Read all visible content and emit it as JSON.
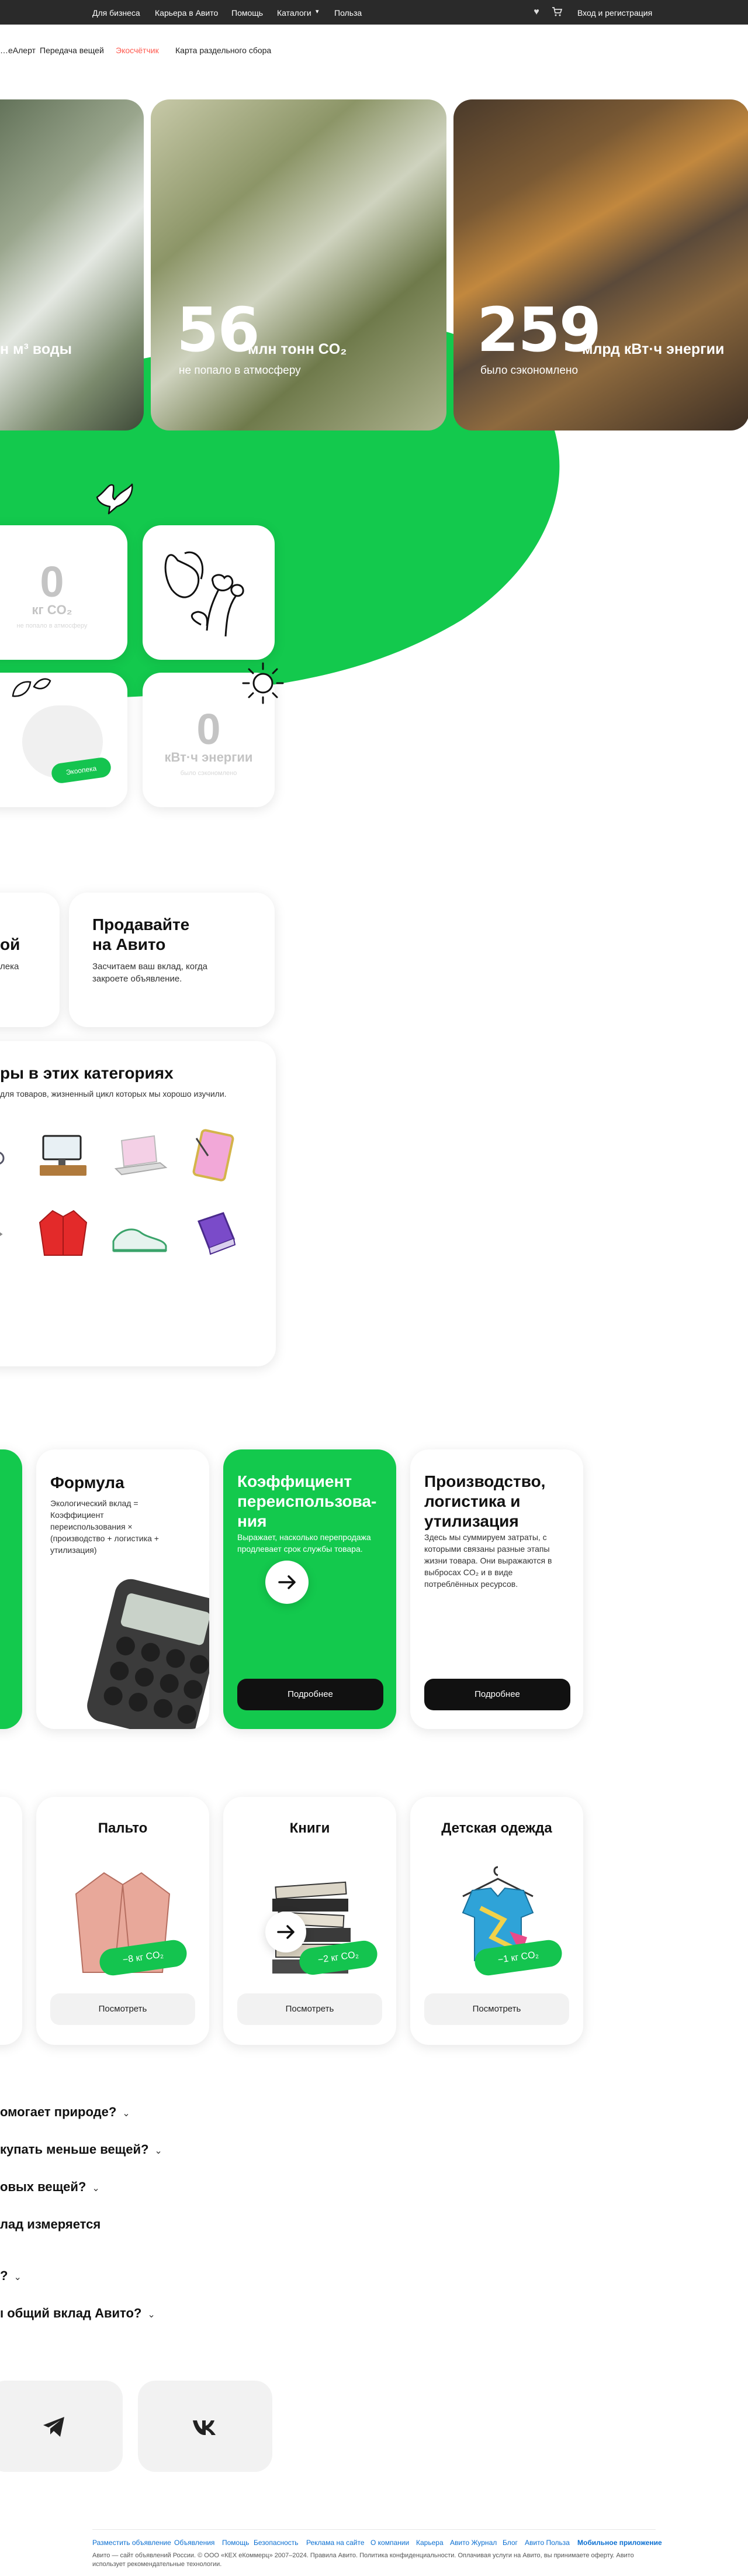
{
  "topbar": {
    "links": [
      "Для бизнеса",
      "Карьера в Авито",
      "Помощь",
      "Каталоги",
      "Польза"
    ],
    "login": "Вход и регистрация"
  },
  "subnav": [
    "…еАлерт",
    "Передача вещей",
    "Экосчётчик",
    "Карта раздельного сбора"
  ],
  "hero": [
    {
      "num": "",
      "unit": "н м³ воды",
      "sub": ""
    },
    {
      "num": "56",
      "unit": "млн тонн CO₂",
      "sub": "не попало в атмосферу"
    },
    {
      "num": "259",
      "unit": "млрд кВт·ч энергии",
      "sub": "было сэкономлено"
    }
  ],
  "tiles": {
    "co2": {
      "zero": "0",
      "unit": "кг CO₂",
      "note": "не попало в атмосферу"
    },
    "energy": {
      "zero": "0",
      "unit": "кВт·ч энергии",
      "note": "было сэкономлено"
    },
    "badge": "Экоопека"
  },
  "sell": {
    "left_title": "ой",
    "left_text": "лека",
    "title": "Продавайте на Авито",
    "text": "Засчитаем ваш вклад, когда закроете объявление."
  },
  "categories": {
    "title": "ры в этих категориях",
    "text": "для товаров, жизненный цикл которых мы хорошо изучили."
  },
  "formula": {
    "f_title": "Формула",
    "f_text": "Экологический вклад = Коэффициент переиспользования × (производство + логистика + утилизация)",
    "k_title": "Коэффициент переиспользова-ния",
    "k_text": "Выражает, насколько перепродажа продлевает срок службы товара.",
    "k_btn": "Подробнее",
    "p_title": "Производство, логистика и утилизация",
    "p_text": "Здесь мы суммируем затраты, с которыми связаны разные этапы жизни товара. Они выражаются в выбросах CO₂ и в виде потреблённых ресурсов.",
    "p_btn": "Подробнее"
  },
  "products": [
    {
      "title": "Пальто",
      "badge": "−8 кг CO₂",
      "btn": "Посмотреть"
    },
    {
      "title": "Книги",
      "badge": "−2 кг CO₂",
      "btn": "Посмотреть"
    },
    {
      "title": "Детская одежда",
      "badge": "−1 кг CO₂",
      "btn": "Посмотреть"
    }
  ],
  "faq": [
    "омогает природе?",
    "купать меньше вещей?",
    "овых вещей?",
    "лад измеряется",
    "?",
    "ı общий вклад Авито?"
  ],
  "footer": {
    "links": [
      "Разместить объявление",
      "Объявления",
      "Помощь",
      "Безопасность",
      "Реклама на сайте",
      "О компании",
      "Карьера",
      "Авито Журнал",
      "Блог",
      "Авито Польза",
      "Мобильное приложение"
    ],
    "copy": "Авито — сайт объявлений России. © ООО «КЕХ еКоммерц» 2007–2024. Правила Авито. Политика конфиденциальности. Оплачивая услуги на Авито, вы принимаете оферту. Авито использует рекомендательные технологии."
  },
  "colors": {
    "green": "#13c94d",
    "dark": "#2a2a2a",
    "accent_red": "#ff5a4f"
  }
}
